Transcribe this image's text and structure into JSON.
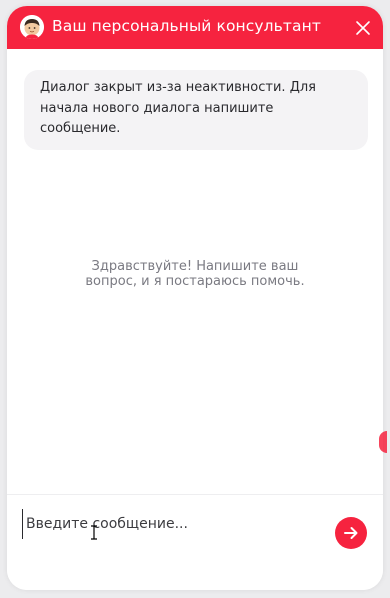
{
  "header": {
    "title": "Ваш персональный консультант",
    "avatar_icon": "consultant-avatar-icon",
    "close_icon": "close-icon"
  },
  "chat": {
    "notice": "Диалог закрыт из-за неактивности. Для начала нового диалога напишите сообщение.",
    "greeting": "Здравствуйте! Напишите ваш вопрос, и я постараюсь помочь."
  },
  "composer": {
    "placeholder": "Введите сообщение...",
    "send_icon": "arrow-right-icon"
  },
  "colors": {
    "accent": "#f6233f",
    "background": "#ffffff",
    "bubble": "#f4f3f5"
  }
}
